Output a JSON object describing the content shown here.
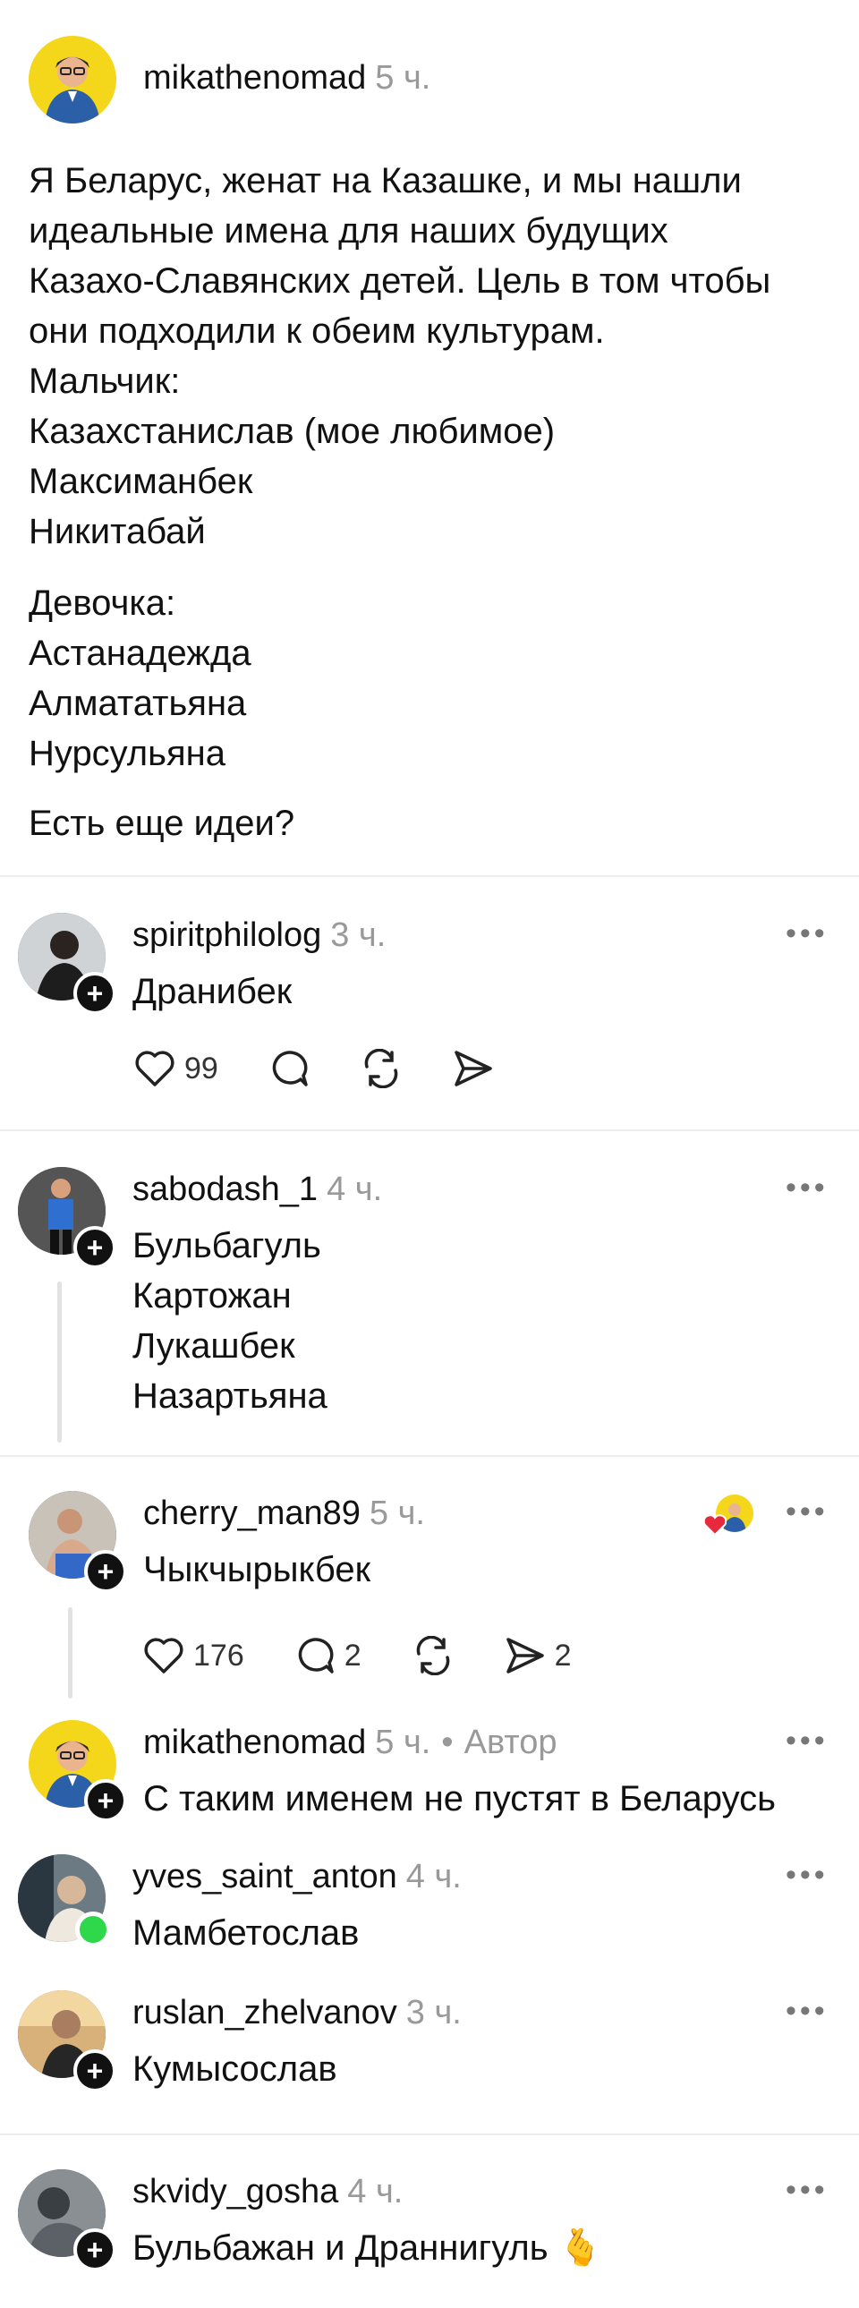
{
  "post": {
    "username": "mikathenomad",
    "time": "5 ч.",
    "lines": [
      "Я Беларус, женат на Казашке, и мы нашли",
      "идеальные имена для наших будущих",
      "Казахо-Славянских детей. Цель в том чтобы",
      "они подходили к обеим культурам.",
      "Мальчик:",
      "Казахстанислав (мое любимое)",
      "Максиманбек",
      "Никитабай"
    ],
    "lines2": [
      "Девочка:",
      "Астанадежда",
      "Алмататьяна",
      "Нурсульяна"
    ],
    "question": "Есть еще идеи?"
  },
  "replies": [
    {
      "username": "spiritphilolog",
      "time": "3 ч.",
      "text": "Дранибек",
      "likes": "99"
    },
    {
      "username": "sabodash_1",
      "time": "4 ч.",
      "lines": [
        "Бульбагуль",
        "Картожан",
        "Лукашбек",
        "Назартьяна"
      ]
    },
    {
      "username": "cherry_man89",
      "time": "5 ч.",
      "text": "Чыкчырыкбек",
      "likes": "176",
      "comments": "2",
      "shares": "2"
    },
    {
      "username": "mikathenomad",
      "time": "5 ч.",
      "author_label": "Автор",
      "text": "С таким именем не пустят в Беларусь"
    },
    {
      "username": "yves_saint_anton",
      "time": "4 ч.",
      "text": "Мамбетослав"
    },
    {
      "username": "ruslan_zhelvanov",
      "time": "3 ч.",
      "text": "Кумысослав"
    },
    {
      "username": "skvidy_gosha",
      "time": "4 ч.",
      "text": "Бульбажан и Драннигуль 🫰"
    }
  ],
  "ui": {
    "more": "•••",
    "dot": "•",
    "plus": "+"
  },
  "icons": [
    "heart-icon",
    "comment-icon",
    "repost-icon",
    "share-icon",
    "follow-plus-icon",
    "more-icon"
  ]
}
